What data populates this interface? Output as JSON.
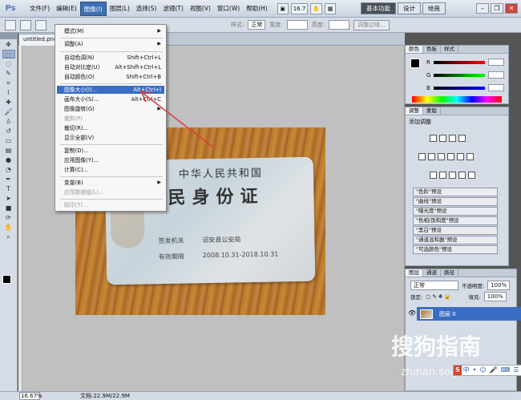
{
  "app": {
    "logo": "Ps"
  },
  "menu": [
    "文件(F)",
    "编辑(E)",
    "图像(I)",
    "图层(L)",
    "选择(S)",
    "滤镜(T)",
    "视图(V)",
    "窗口(W)",
    "帮助(H)"
  ],
  "titlebar": {
    "zoom_value": "16.7"
  },
  "workspaces": [
    "基本功能",
    "设计",
    "绘画"
  ],
  "options": {
    "style_label": "样式:",
    "style_value": "正常",
    "width_label": "宽度:",
    "height_label": "高度:",
    "refine_button": "调整边缘..."
  },
  "document": {
    "tab": "untitled.png"
  },
  "image_menu": {
    "items": [
      {
        "label": "模式(M)",
        "shortcut": "",
        "submenu": true,
        "state": "normal"
      },
      {
        "label": "调整(A)",
        "shortcut": "",
        "submenu": true,
        "state": "normal"
      },
      {
        "label": "自动色调(N)",
        "shortcut": "Shift+Ctrl+L",
        "submenu": false,
        "state": "normal"
      },
      {
        "label": "自动对比度(U)",
        "shortcut": "Alt+Shift+Ctrl+L",
        "submenu": false,
        "state": "normal"
      },
      {
        "label": "自动颜色(O)",
        "shortcut": "Shift+Ctrl+B",
        "submenu": false,
        "state": "normal"
      },
      {
        "label": "图像大小(I)...",
        "shortcut": "Alt+Ctrl+I",
        "submenu": false,
        "state": "highlighted"
      },
      {
        "label": "画布大小(S)...",
        "shortcut": "Alt+Ctrl+C",
        "submenu": false,
        "state": "normal"
      },
      {
        "label": "图像旋转(G)",
        "shortcut": "",
        "submenu": true,
        "state": "normal"
      },
      {
        "label": "裁剪(P)",
        "shortcut": "",
        "submenu": false,
        "state": "disabled"
      },
      {
        "label": "裁切(R)...",
        "shortcut": "",
        "submenu": false,
        "state": "normal"
      },
      {
        "label": "显示全部(V)",
        "shortcut": "",
        "submenu": false,
        "state": "normal"
      },
      {
        "label": "复制(D)...",
        "shortcut": "",
        "submenu": false,
        "state": "normal"
      },
      {
        "label": "应用图像(Y)...",
        "shortcut": "",
        "submenu": false,
        "state": "normal"
      },
      {
        "label": "计算(C)...",
        "shortcut": "",
        "submenu": false,
        "state": "normal"
      },
      {
        "label": "变量(B)",
        "shortcut": "",
        "submenu": true,
        "state": "normal"
      },
      {
        "label": "应用数据组(L)...",
        "shortcut": "",
        "submenu": false,
        "state": "disabled"
      },
      {
        "label": "陷印(T)...",
        "shortcut": "",
        "submenu": false,
        "state": "disabled"
      }
    ]
  },
  "id_card": {
    "country": "中华人民共和国",
    "title": "居民身份证",
    "authority_label": "签发机关",
    "authority_value": "诏安县公安局",
    "validity_label": "有效期限",
    "validity_value": "2008.10.31-2018.10.31"
  },
  "color_panel": {
    "tabs": [
      "颜色",
      "色板",
      "样式"
    ],
    "channels": [
      "R",
      "G",
      "B"
    ]
  },
  "adjust_panel": {
    "tabs": [
      "调整",
      "蒙版"
    ],
    "title": "添加调整",
    "presets": [
      "\"色阶\"预设",
      "\"曲线\"预设",
      "\"曝光度\"预设",
      "\"色相/饱和度\"预设",
      "\"黑白\"预设",
      "\"通道混和器\"预设",
      "\"可选颜色\"预设"
    ]
  },
  "layers_panel": {
    "tabs": [
      "图层",
      "通道",
      "路径"
    ],
    "blend_mode": "正常",
    "opacity_label": "不透明度:",
    "opacity_value": "100%",
    "lock_label": "锁定:",
    "fill_label": "填充:",
    "fill_value": "100%",
    "layer_name": "图层 0"
  },
  "status": {
    "zoom": "16.67%",
    "doc_info": "文档:22.9M/22.9M"
  },
  "watermark": {
    "text": "搜狗指南",
    "url": "zhinan.sogou"
  },
  "ime": [
    "S",
    "中",
    "•",
    "☺",
    "🎤",
    "⌨",
    "☰"
  ],
  "colors": {
    "highlight": "#3a6ec4",
    "arrow": "#e03a3a"
  }
}
